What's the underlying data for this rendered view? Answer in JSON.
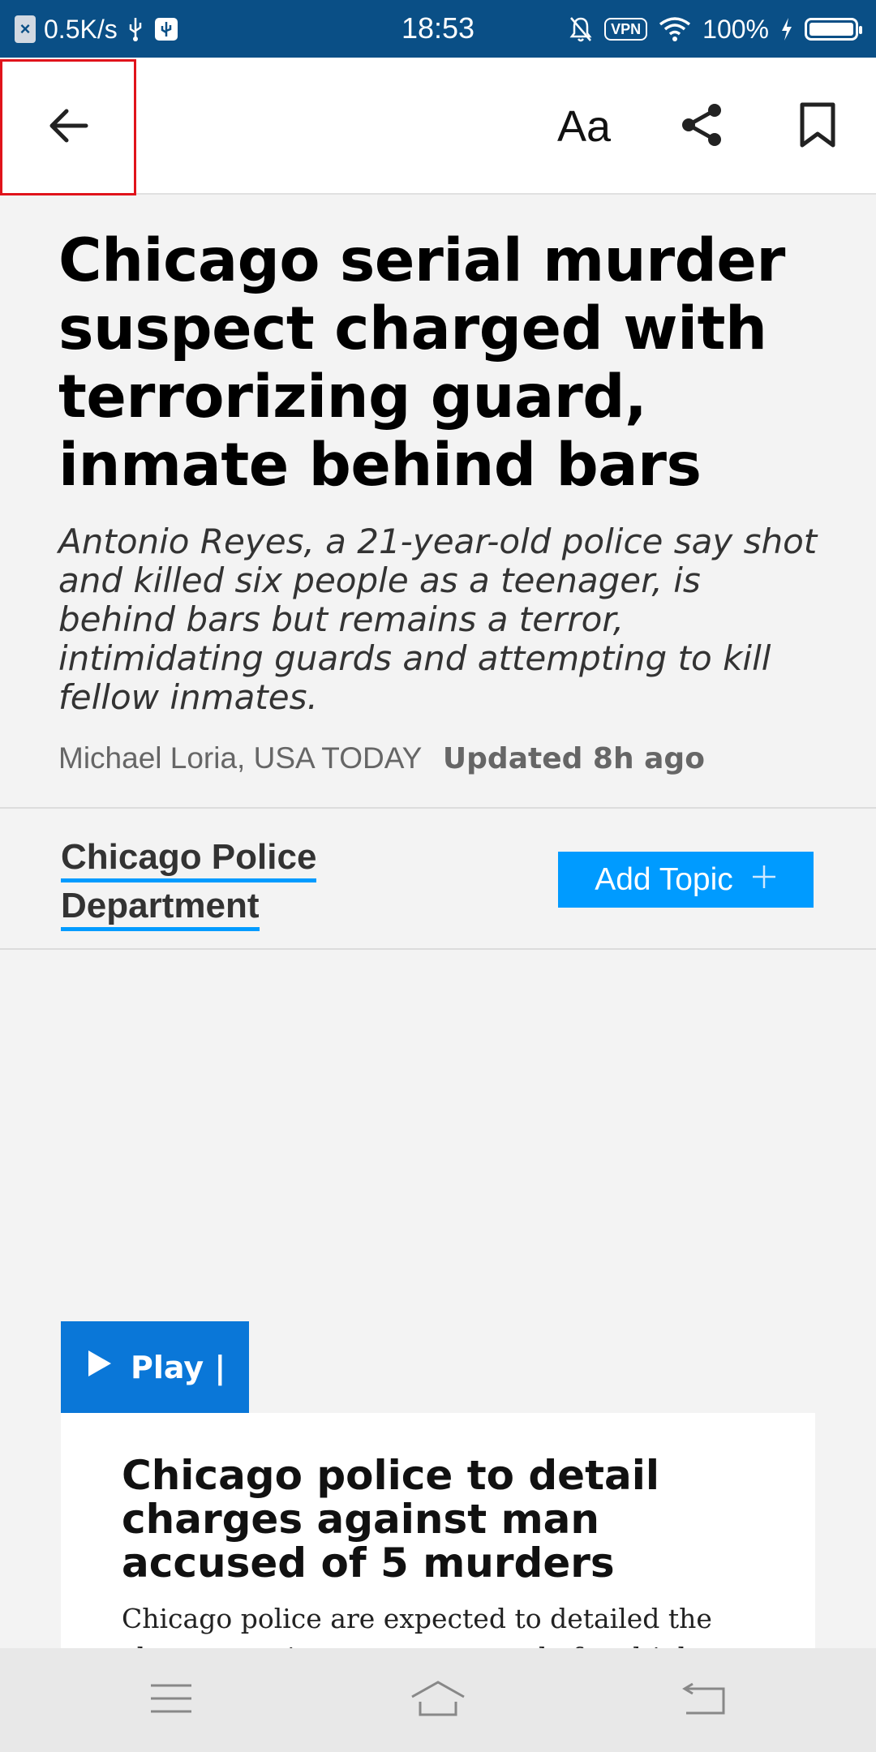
{
  "status_bar": {
    "net_speed": "0.5K/s",
    "time": "18:53",
    "vpn": "VPN",
    "battery": "100%"
  },
  "toolbar": {
    "text_size_label": "Aa"
  },
  "article": {
    "headline": "Chicago serial murder suspect charged with terrorizing guard, inmate behind bars",
    "summary": "Antonio Reyes, a 21-year-old police say shot and killed six people as a teenager, is behind bars but remains a terror, intimidating guards and attempting to kill fellow inmates.",
    "byline": "Michael Loria, USA TODAY",
    "updated": "Updated 8h ago"
  },
  "topic": {
    "name": "Chicago Police Department",
    "add_label": "Add Topic",
    "add_icon": "+"
  },
  "video": {
    "play_label": "Play |",
    "title": "Chicago police to detail charges against man accused of 5 murders",
    "description": "Chicago police are expected to detailed the charges against a man accused of multiple fatal"
  },
  "colors": {
    "status_bar": "#0a4f86",
    "accent": "#009bff",
    "play_button": "#0a77d8",
    "highlight_border": "#e0131b"
  }
}
